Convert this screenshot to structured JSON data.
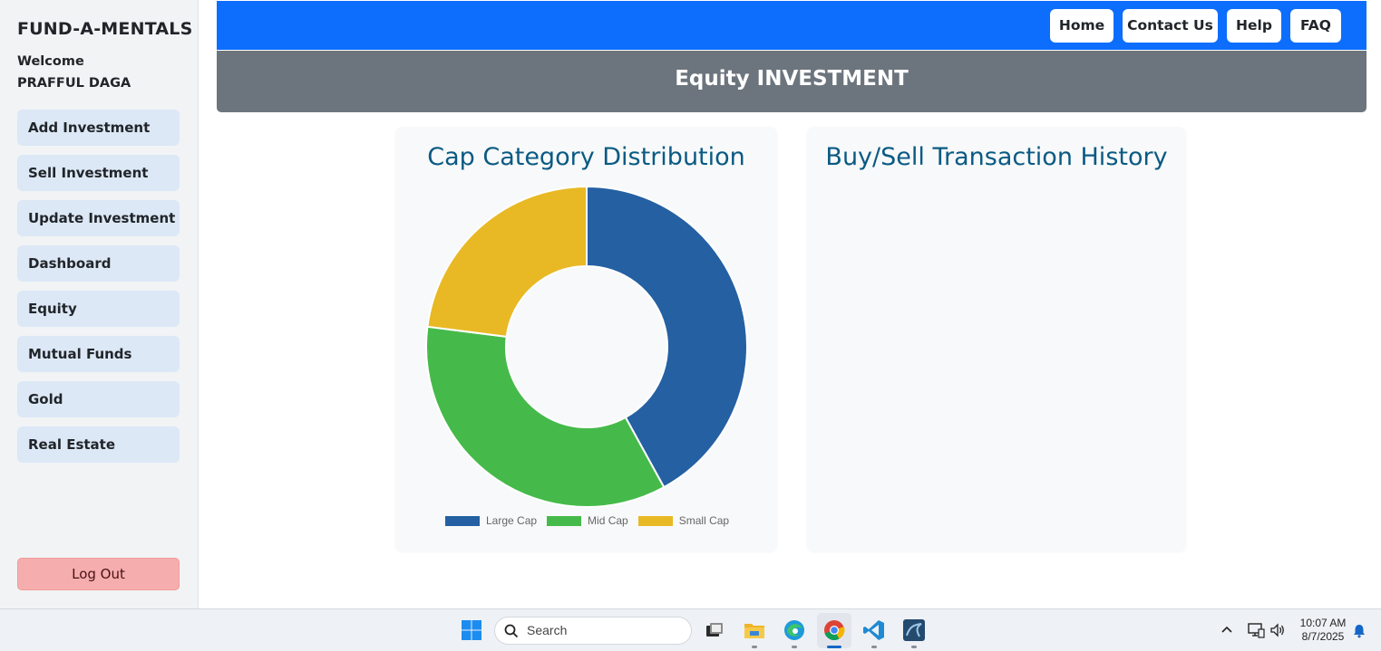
{
  "sidebar": {
    "brand": "FUND-A-MENTALS",
    "welcome": "Welcome",
    "user": "PRAFFUL DAGA",
    "items": [
      {
        "label": "Add Investment"
      },
      {
        "label": "Sell Investment"
      },
      {
        "label": "Update Investment"
      },
      {
        "label": "Dashboard"
      },
      {
        "label": "Equity"
      },
      {
        "label": "Mutual Funds"
      },
      {
        "label": "Gold"
      },
      {
        "label": "Real Estate"
      }
    ],
    "logout": "Log Out"
  },
  "topnav": {
    "home": "Home",
    "contact": "Contact Us",
    "help": "Help",
    "faq": "FAQ"
  },
  "banner": {
    "title": "Equity INVESTMENT"
  },
  "cards": {
    "distribution_title": "Cap Category Distribution",
    "history_title": "Buy/Sell Transaction History"
  },
  "chart_data": {
    "type": "pie",
    "variant": "doughnut",
    "title": "Cap Category Distribution",
    "categories": [
      "Large Cap",
      "Mid Cap",
      "Small Cap"
    ],
    "values": [
      42,
      35,
      23
    ],
    "colors": [
      "#2460a2",
      "#45ba4a",
      "#e8b925"
    ],
    "legend_position": "bottom"
  },
  "taskbar": {
    "search_placeholder": "Search",
    "time": "10:07 AM",
    "date": "8/7/2025",
    "icons": [
      "windows-start-icon",
      "search-icon",
      "task-view-icon",
      "file-explorer-icon",
      "edge-icon",
      "chrome-icon",
      "vscode-icon",
      "mysql-workbench-icon",
      "chevron-up-icon",
      "network-icon",
      "volume-icon",
      "notification-bell-icon"
    ]
  }
}
